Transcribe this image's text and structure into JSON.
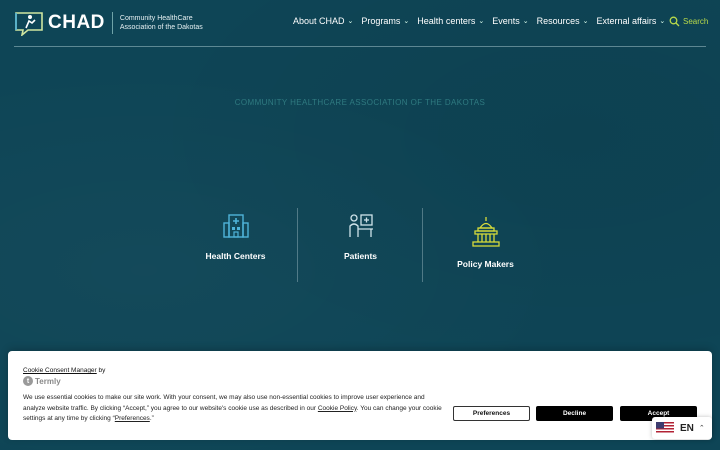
{
  "brand": {
    "logo_text": "CHAD",
    "tagline_line1": "Community HealthCare",
    "tagline_line2": "Association of the Dakotas"
  },
  "nav": {
    "items": [
      {
        "label": "About CHAD"
      },
      {
        "label": "Programs"
      },
      {
        "label": "Health centers"
      },
      {
        "label": "Events"
      },
      {
        "label": "Resources"
      },
      {
        "label": "External affairs"
      }
    ],
    "search_label": "Search"
  },
  "hero": {
    "kicker": "COMMUNITY HEALTHCARE ASSOCIATION OF THE DAKOTAS"
  },
  "audience": {
    "cards": [
      {
        "label": "Health Centers",
        "icon": "hospital-icon"
      },
      {
        "label": "Patients",
        "icon": "patient-desk-icon"
      },
      {
        "label": "Policy Makers",
        "icon": "capitol-icon"
      }
    ]
  },
  "cookie": {
    "title_link": "Cookie Consent Manager",
    "title_suffix": " by",
    "termly_label": "Termly",
    "body_part1": "We use essential cookies to make our site work. With your consent, we may also use non-essential cookies to improve user experience and analyze website traffic. By clicking “Accept,” you agree to our website's cookie use as described in our ",
    "cookie_policy_link": "Cookie Policy",
    "body_part2": ". You can change your cookie settings at any time by clicking “",
    "preferences_link": "Preferences",
    "body_part3": ".”",
    "buttons": {
      "preferences": "Preferences",
      "decline": "Decline",
      "accept": "Accept"
    }
  },
  "language": {
    "code": "EN",
    "flag": "us-flag-icon"
  },
  "colors": {
    "background": "#0e4556",
    "accent_green": "#b8d94a",
    "icon_blue": "#4fb3d9",
    "icon_yellow": "#d7dc3a"
  }
}
